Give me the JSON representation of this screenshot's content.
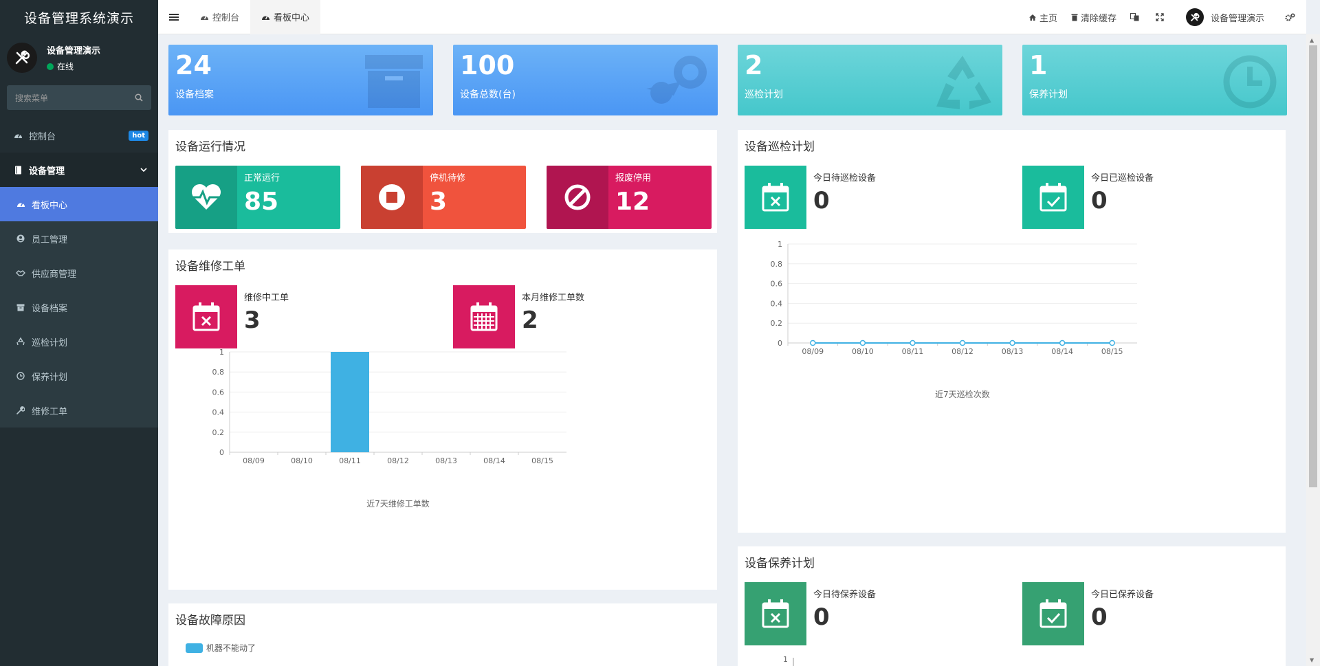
{
  "sidebar": {
    "logo": "设备管理系统演示",
    "user_name": "设备管理演示",
    "user_status": "在线",
    "search_placeholder": "搜索菜单",
    "items": [
      {
        "label": "控制台",
        "badge": "hot"
      },
      {
        "label": "设备管理"
      }
    ],
    "submenu": [
      {
        "label": "看板中心"
      },
      {
        "label": "员工管理"
      },
      {
        "label": "供应商管理"
      },
      {
        "label": "设备档案"
      },
      {
        "label": "巡检计划"
      },
      {
        "label": "保养计划"
      },
      {
        "label": "维修工单"
      }
    ]
  },
  "topbar": {
    "tabs": [
      {
        "label": "控制台"
      },
      {
        "label": "看板中心"
      }
    ],
    "home": "主页",
    "clear_cache": "清除缓存",
    "user_name": "设备管理演示"
  },
  "stats": [
    {
      "value": "24",
      "label": "设备档案",
      "color": "#5aa4f5"
    },
    {
      "value": "100",
      "label": "设备总数(台)",
      "color": "#5aa4f5"
    },
    {
      "value": "2",
      "label": "巡检计划",
      "color": "#56cdd1"
    },
    {
      "value": "1",
      "label": "保养计划",
      "color": "#56cdd1"
    }
  ],
  "running": {
    "title": "设备运行情况",
    "boxes": [
      {
        "label": "正常运行",
        "value": "85"
      },
      {
        "label": "停机待修",
        "value": "3"
      },
      {
        "label": "报废停用",
        "value": "12"
      }
    ]
  },
  "repair": {
    "title": "设备维修工单",
    "boxes": [
      {
        "label": "维修中工单",
        "value": "3"
      },
      {
        "label": "本月维修工单数",
        "value": "2"
      }
    ]
  },
  "inspection": {
    "title": "设备巡检计划",
    "boxes": [
      {
        "label": "今日待巡检设备",
        "value": "0"
      },
      {
        "label": "今日已巡检设备",
        "value": "0"
      }
    ]
  },
  "maintenance": {
    "title": "设备保养计划",
    "boxes": [
      {
        "label": "今日待保养设备",
        "value": "0"
      },
      {
        "label": "今日已保养设备",
        "value": "0"
      }
    ]
  },
  "fault": {
    "title": "设备故障原因",
    "legend": "机器不能动了",
    "legend_color": "#3fb1e3"
  },
  "chart_data": [
    {
      "type": "bar",
      "title": "近7天维修工单数",
      "categories": [
        "08/09",
        "08/10",
        "08/11",
        "08/12",
        "08/13",
        "08/14",
        "08/15"
      ],
      "values": [
        0,
        0,
        1,
        0,
        0,
        0,
        0
      ],
      "ylim": [
        0,
        1
      ],
      "yticks": [
        "0",
        "0.2",
        "0.4",
        "0.6",
        "0.8",
        "1"
      ],
      "color": "#3fb1e3"
    },
    {
      "type": "line",
      "title": "近7天巡检次数",
      "categories": [
        "08/09",
        "08/10",
        "08/11",
        "08/12",
        "08/13",
        "08/14",
        "08/15"
      ],
      "values": [
        0,
        0,
        0,
        0,
        0,
        0,
        0
      ],
      "ylim": [
        0,
        1
      ],
      "yticks": [
        "0",
        "0.2",
        "0.4",
        "0.6",
        "0.8",
        "1"
      ],
      "color": "#3fb1e3"
    }
  ],
  "maintenance_chart": {
    "ytick_top": "1"
  }
}
